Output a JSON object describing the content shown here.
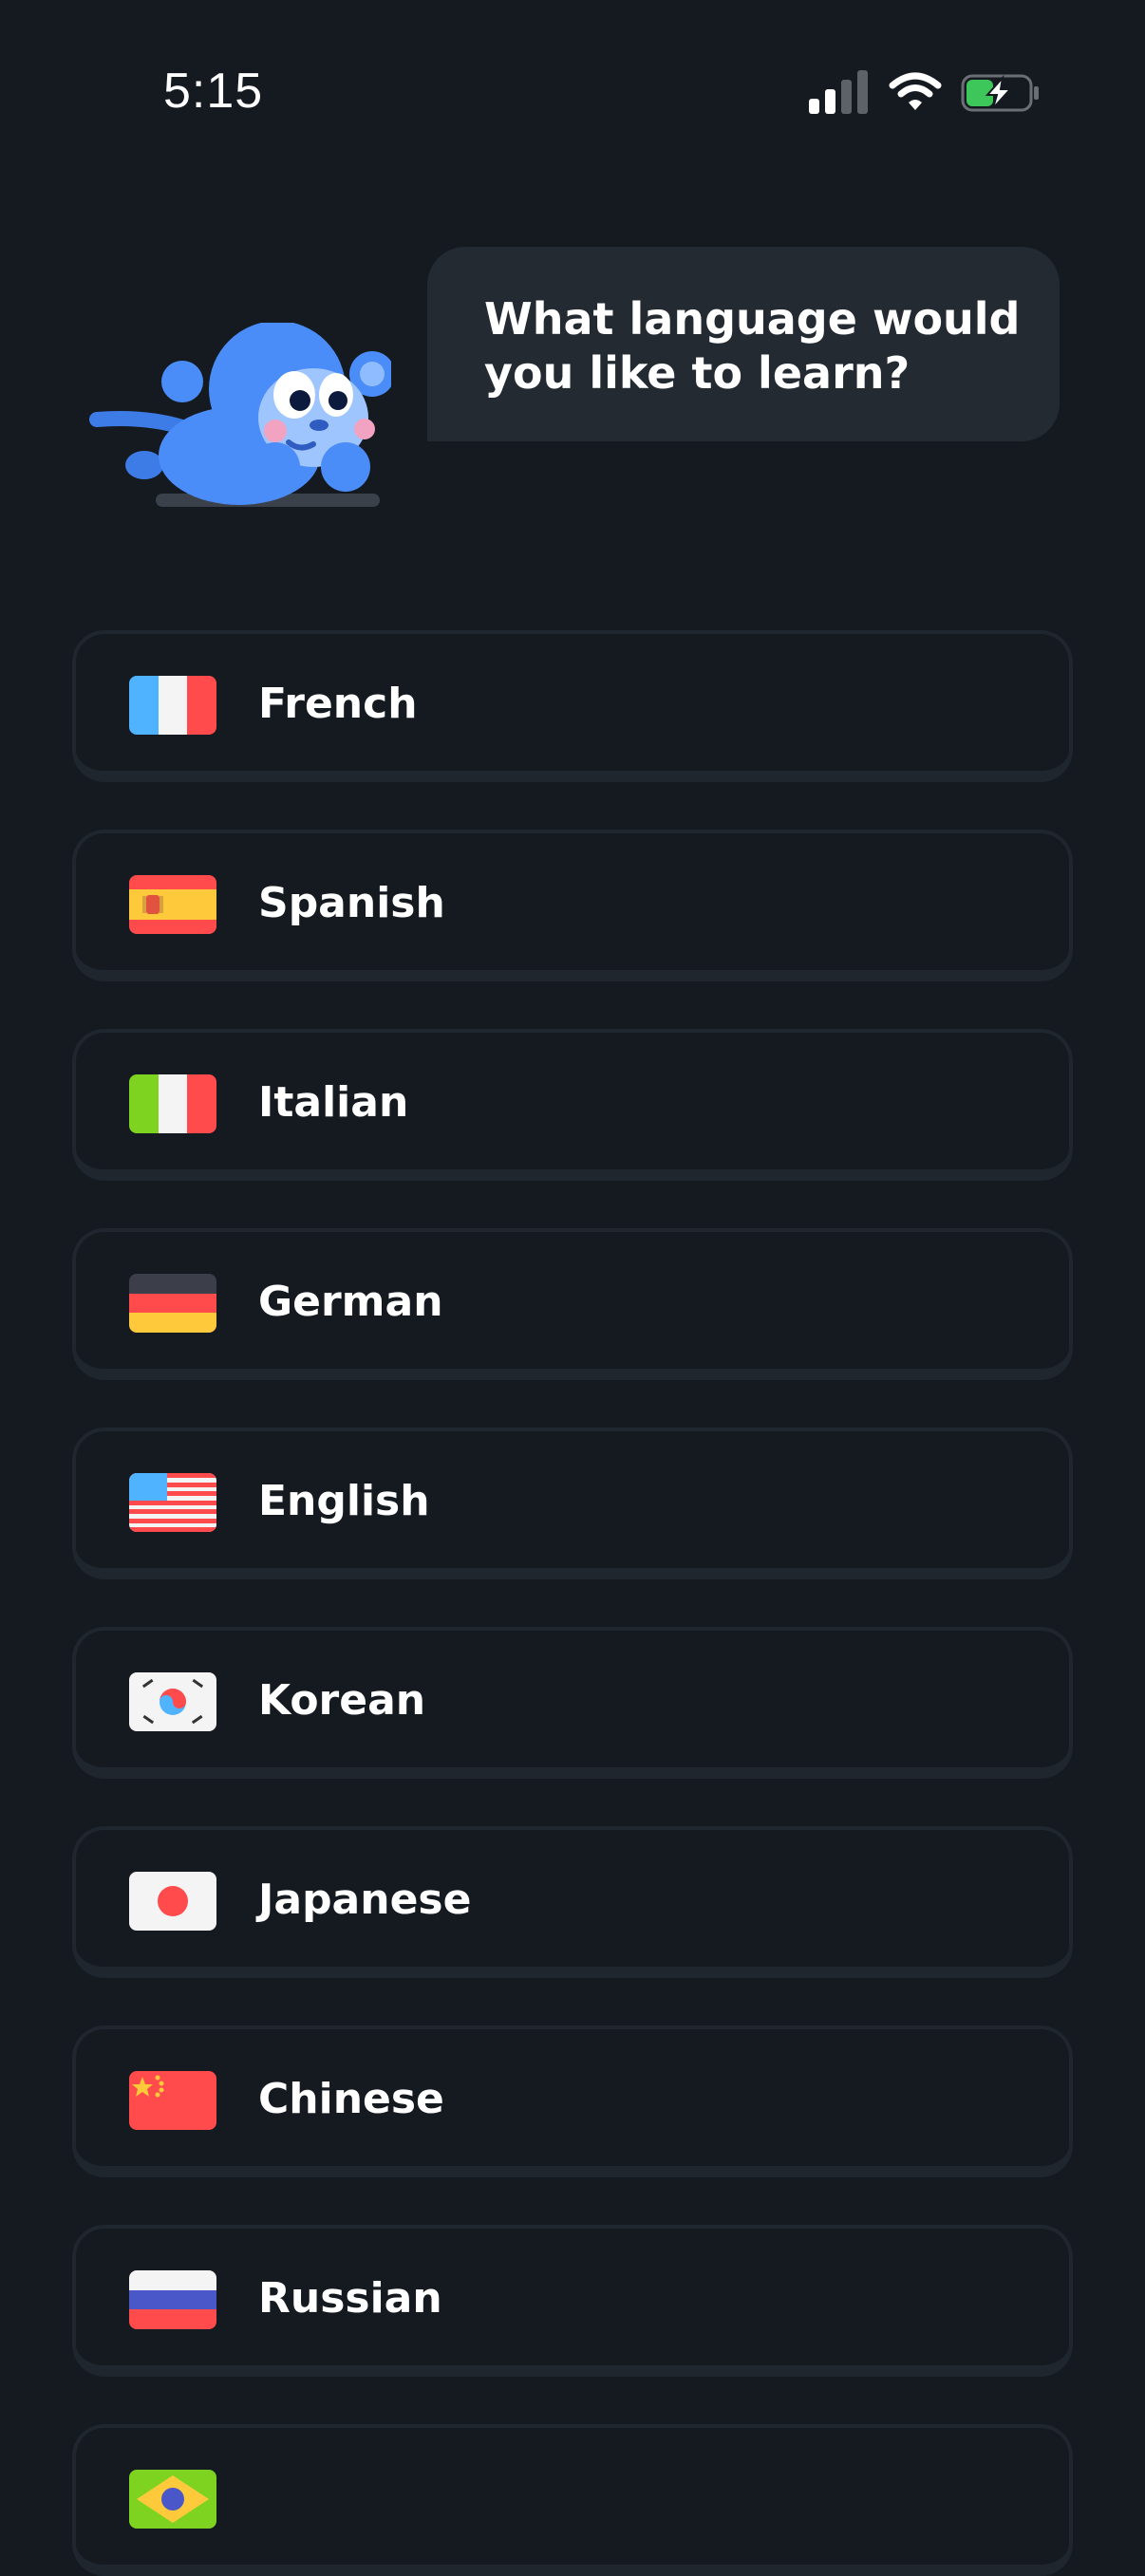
{
  "status_bar": {
    "time": "5:15",
    "icons": [
      "cellular-signal-icon",
      "wifi-icon",
      "battery-charging-icon"
    ]
  },
  "prompt": {
    "question": "What language would you like to learn?",
    "mascot": "blue-monkey-mascot"
  },
  "languages": [
    {
      "label": "French",
      "flag": "france-flag-icon"
    },
    {
      "label": "Spanish",
      "flag": "spain-flag-icon"
    },
    {
      "label": "Italian",
      "flag": "italy-flag-icon"
    },
    {
      "label": "German",
      "flag": "germany-flag-icon"
    },
    {
      "label": "English",
      "flag": "usa-flag-icon"
    },
    {
      "label": "Korean",
      "flag": "south-korea-flag-icon"
    },
    {
      "label": "Japanese",
      "flag": "japan-flag-icon"
    },
    {
      "label": "Chinese",
      "flag": "china-flag-icon"
    },
    {
      "label": "Russian",
      "flag": "russia-flag-icon"
    },
    {
      "label": "",
      "flag": "brazil-flag-icon"
    }
  ],
  "colors": {
    "background": "#151a21",
    "card_border": "#20262e",
    "bubble": "#232a32",
    "mascot_blue": "#4b8df8",
    "battery_green": "#3dc659"
  }
}
